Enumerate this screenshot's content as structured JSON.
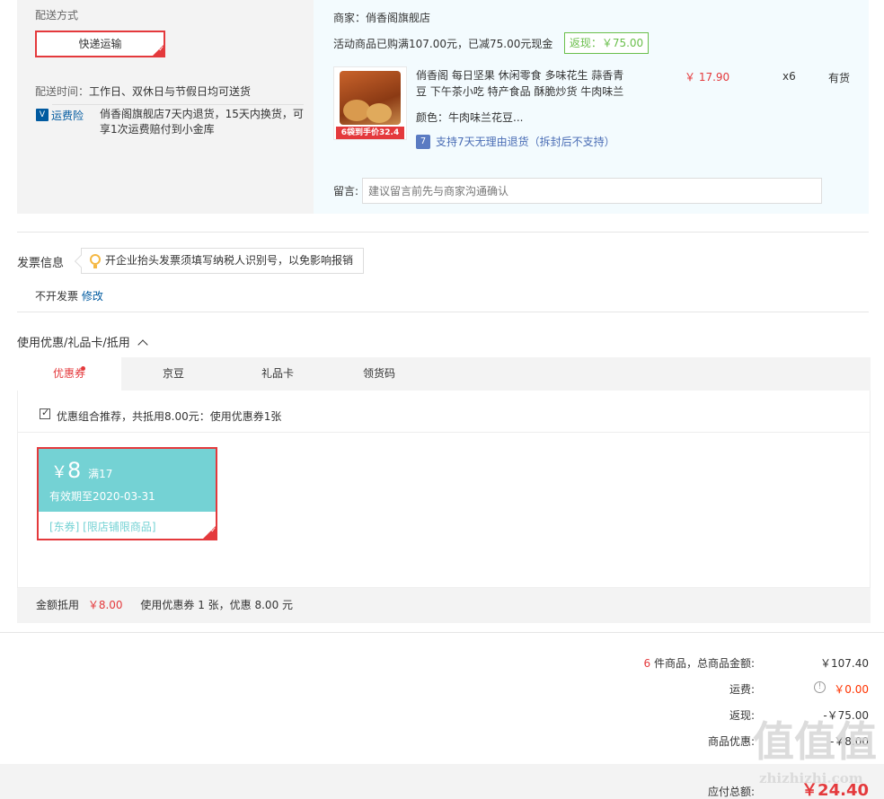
{
  "shipping": {
    "section_label": "配送方式",
    "method_button": "快递运输",
    "time_label": "配送时间：",
    "time_value": "工作日、双休日与节假日均可送货",
    "insurance_icon": "shield-icon",
    "insurance_label": "运费险",
    "insurance_desc_line1": "俏香阁旗舰店7天内退货，15天内换货，可",
    "insurance_desc_line2": "享1次运费赔付到小金库"
  },
  "order": {
    "merchant_label": "商家：俏香阁旗舰店",
    "promo_text": "活动商品已购满107.00元，已减75.00元现金",
    "fanxian_badge": "返现：￥75.00",
    "product": {
      "title_line1": "俏香阁 每日坚果 休闲零食 多味花生 蒜香青",
      "title_line2": "豆 下午茶小吃 特产食品 酥脆炒货 牛肉味兰",
      "image_tag": "6袋到手价32.4",
      "color": "颜色：牛肉味兰花豆...",
      "return_icon": "return-icon",
      "return_text": "支持7天无理由退货（拆封后不支持）",
      "price": "￥ 17.90",
      "qty": "x6",
      "stock": "有货"
    },
    "remark_label": "留言:",
    "remark_placeholder": "建议留言前先与商家沟通确认"
  },
  "invoice": {
    "title": "发票信息",
    "tip": "开企业抬头发票须填写纳税人识别号，以免影响报销",
    "value": "不开发票",
    "edit_link": "修改"
  },
  "discount": {
    "title": "使用优惠/礼品卡/抵用",
    "collapse_icon": "chevron-up-icon",
    "tabs": [
      {
        "label": "优惠券"
      },
      {
        "label": "京豆"
      },
      {
        "label": "礼品卡"
      },
      {
        "label": "领货码"
      }
    ],
    "recommend_text": "优惠组合推荐，共抵用8.00元：使用优惠券1张",
    "coupon": {
      "currency": "￥",
      "amount": "8",
      "condition": "满17",
      "validity": "有效期至2020-03-31",
      "tags": "[东券]  [限店铺限商品]"
    },
    "summary_label": "金额抵用",
    "summary_amount": "￥8.00",
    "summary_desc": "使用优惠券 1 张，优惠 8.00 元"
  },
  "totals": {
    "items_count": "6",
    "items_label": " 件商品，总商品金额:",
    "items_value": "￥107.40",
    "shipping_label": "运费:",
    "shipping_value": "￥0.00",
    "info_icon": "info-icon",
    "fanxian_label": "返现:",
    "fanxian_value": "-￥75.00",
    "coupon_label": "商品优惠:",
    "coupon_value": "-￥8.00",
    "payable_label": "应付总额:",
    "payable_value": "￥24.40"
  },
  "watermark": {
    "logo": "值值值",
    "url": "zhizhizhi.com"
  }
}
